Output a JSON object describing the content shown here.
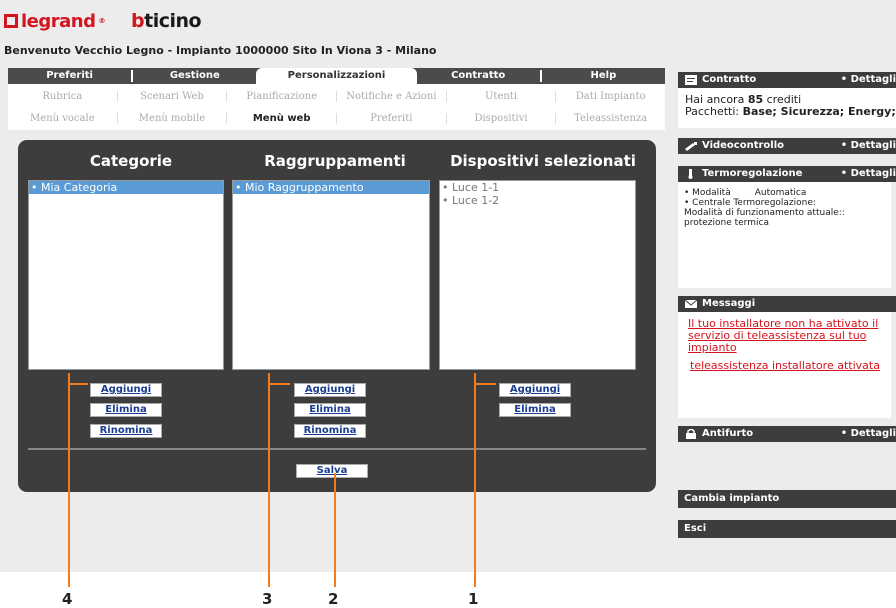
{
  "brand": {
    "legrand": "legrand",
    "bticino_b": "b",
    "bticino_rest": "ticino"
  },
  "welcome": "Benvenuto Vecchio Legno - Impianto 1000000 Sito In Viona 3 - Milano",
  "nav": {
    "tabs": [
      "Preferiti",
      "Gestione",
      "Personalizzazioni",
      "Contratto",
      "Help"
    ],
    "active": "Personalizzazioni"
  },
  "subnav": {
    "row1": [
      "Rubrica",
      "Scenari Web",
      "Pianificazione",
      "Notifiche e Azioni",
      "Utenti",
      "Dati Impianto"
    ],
    "row2": [
      "Menù vocale",
      "Menù mobile",
      "Menù web",
      "Preferiti",
      "Dispositivi",
      "Teleassistenza"
    ],
    "active": "Menù web"
  },
  "panel": {
    "categorie": {
      "title": "Categorie",
      "items": [
        "• Mia Categoria"
      ]
    },
    "raggruppamenti": {
      "title": "Raggruppamenti",
      "items": [
        "• Mio Raggruppamento"
      ]
    },
    "dispositivi": {
      "title": "Dispositivi selezionati",
      "items": [
        "• Luce 1-1",
        "• Luce 1-2"
      ]
    },
    "buttons": {
      "aggiungi": "Aggiungi",
      "elimina": "Elimina",
      "rinomina": "Rinomina",
      "salva": "Salva"
    }
  },
  "sidebar": {
    "contratto": {
      "title": "Contratto",
      "details": "• Dettagli",
      "crediti_prefix": "Hai ancora ",
      "crediti_value": "85",
      "crediti_suffix": " crediti",
      "pacchetti_label": "Pacchetti: ",
      "pacchetti_value": "Base; Sicurezza; Energy;"
    },
    "videocontrollo": {
      "title": "Videocontrollo",
      "details": "• Dettagli"
    },
    "termoregolazione": {
      "title": "Termoregolazione",
      "details": "• Dettagli",
      "modalita_label": "• Modalità",
      "modalita_value": "Automatica",
      "centrale": "• Centrale Termoregolazione:",
      "funzionamento": "Modalità di funzionamento attuale::",
      "stato": "protezione termica"
    },
    "messaggi": {
      "title": "Messaggi",
      "msg1": "Il tuo installatore non ha attivato il servizio di teleassistenza sul tuo impianto",
      "msg2": "teleassistenza installatore attivata"
    },
    "antifurto": {
      "title": "Antifurto",
      "details": "• Dettagli"
    },
    "cambia": "Cambia impianto",
    "esci": "Esci"
  },
  "annotations": [
    "4",
    "3",
    "2",
    "1"
  ],
  "colors": {
    "accent": "#f07c22",
    "brand_red": "#d4141e",
    "panel_dark": "#3d3d3d",
    "selection": "#5a9bd5",
    "link_blue": "#1b3d8f"
  }
}
